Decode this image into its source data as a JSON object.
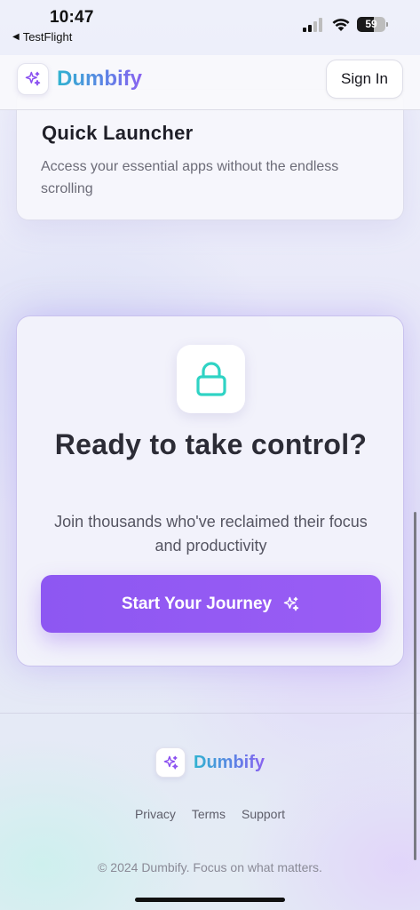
{
  "status_bar": {
    "time": "10:47",
    "back_label": "TestFlight",
    "battery": "59",
    "battery_level": 0.59
  },
  "header": {
    "brand": "Dumbify",
    "sign_in_label": "Sign In"
  },
  "feature_card": {
    "title": "Quick Launcher",
    "description": "Access your essential apps without the endless scrolling"
  },
  "cta": {
    "icon": "lock-icon",
    "title": "Ready to take control?",
    "subtitle": "Join thousands who've reclaimed their focus and productivity",
    "button_label": "Start Your Journey",
    "button_icon": "sparkles-icon"
  },
  "footer": {
    "brand": "Dumbify",
    "links": [
      "Privacy",
      "Terms",
      "Support"
    ],
    "copyright": "© 2024 Dumbify. Focus on what matters."
  },
  "colors": {
    "accent_purple": "#8d57f2",
    "lock_teal": "#2fd3c4",
    "brand_gradient_start": "#30b3d0",
    "brand_gradient_end": "#8a63f0"
  }
}
